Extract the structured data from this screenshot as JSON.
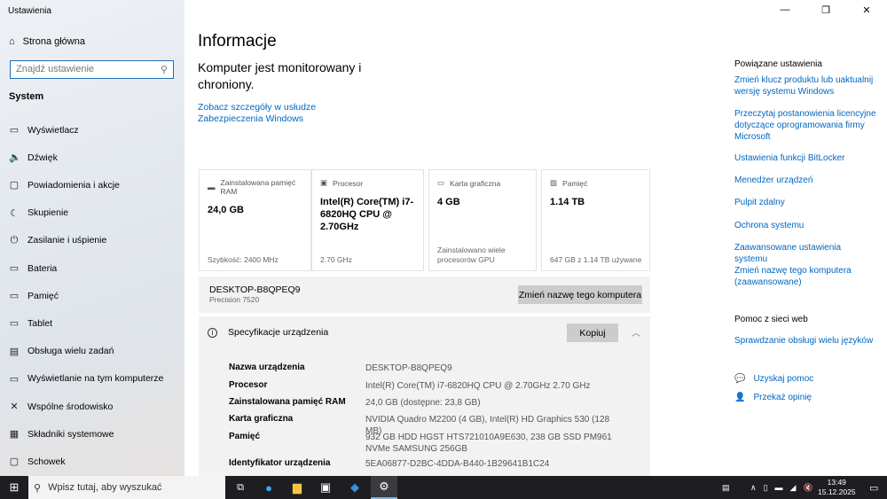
{
  "window": {
    "title": "Ustawienia",
    "minimize": "—",
    "maximize": "❐",
    "close": "✕"
  },
  "sidebar": {
    "home": "Strona główna",
    "search_placeholder": "Znajdź ustawienie",
    "section": "System",
    "items": [
      {
        "label": "Wyświetlacz",
        "icon": "▭"
      },
      {
        "label": "Dźwięk",
        "icon": "🔈"
      },
      {
        "label": "Powiadomienia i akcje",
        "icon": "▢"
      },
      {
        "label": "Skupienie",
        "icon": "☾"
      },
      {
        "label": "Zasilanie i uśpienie",
        "icon": "⏻"
      },
      {
        "label": "Bateria",
        "icon": "▭"
      },
      {
        "label": "Pamięć",
        "icon": "▭"
      },
      {
        "label": "Tablet",
        "icon": "▭"
      },
      {
        "label": "Obsługa wielu zadań",
        "icon": "▤"
      },
      {
        "label": "Wyświetlanie na tym komputerze",
        "icon": "▭"
      },
      {
        "label": "Wspólne środowisko",
        "icon": "✕"
      },
      {
        "label": "Składniki systemowe",
        "icon": "▦"
      },
      {
        "label": "Schowek",
        "icon": "▢"
      }
    ]
  },
  "main": {
    "title": "Informacje",
    "protection": "Komputer jest monitorowany i chroniony.",
    "security_link": "Zobacz szczegóły w usłudze Zabezpieczenia Windows",
    "cards": [
      {
        "label": "Zainstalowana pamięć RAM",
        "value": "24,0 GB",
        "sub": "Szybkość: 2400 MHz"
      },
      {
        "label": "Procesor",
        "value": "Intel(R) Core(TM) i7-6820HQ CPU @ 2.70GHz",
        "sub": "2.70 GHz"
      },
      {
        "label": "Karta graficzna",
        "value": "4 GB",
        "sub": "Zainstalowano wiele procesorów GPU"
      },
      {
        "label": "Pamięć",
        "value": "1.14 TB",
        "sub": "647 GB z 1.14 TB używane"
      }
    ],
    "device_name": "DESKTOP-B8QPEQ9",
    "model": "Precision 7520",
    "rename_button": "Zmień nazwę tego komputera",
    "spec_title": "Specyfikacje urządzenia",
    "copy_button": "Kopiuj",
    "specs": [
      {
        "k": "Nazwa urządzenia",
        "v": "DESKTOP-B8QPEQ9"
      },
      {
        "k": "Procesor",
        "v": "Intel(R) Core(TM) i7-6820HQ CPU @ 2.70GHz   2.70 GHz"
      },
      {
        "k": "Zainstalowana pamięć RAM",
        "v": "24,0 GB (dostępne: 23,8 GB)"
      },
      {
        "k": "Karta graficzna",
        "v": "NVIDIA Quadro M2200 (4 GB), Intel(R) HD Graphics 530 (128 MB)"
      },
      {
        "k": "Pamięć",
        "v": "932 GB HDD HGST HTS721010A9E630, 238 GB SSD PM961 NVMe SAMSUNG 256GB"
      },
      {
        "k": "Identyfikator urządzenia",
        "v": "5EA06877-D2BC-4DDA-B440-1B29641B1C24"
      }
    ]
  },
  "right": {
    "related_title": "Powiązane ustawienia",
    "related": [
      "Zmień klucz produktu lub uaktualnij wersję systemu Windows",
      "Przeczytaj postanowienia licencyjne dotyczące oprogramowania firmy Microsoft",
      "Ustawienia funkcji BitLocker",
      "Menedżer urządzeń",
      "Pulpit zdalny",
      "Ochrona systemu",
      "Zaawansowane ustawienia systemu",
      "Zmień nazwę tego komputera (zaawansowane)"
    ],
    "help_title": "Pomoc z sieci web",
    "help": [
      "Sprawdzanie obsługi wielu języków"
    ],
    "get_help": "Uzyskaj pomoc",
    "feedback": "Przekaż opinię"
  },
  "taskbar": {
    "search_placeholder": "Wpisz tutaj, aby wyszukać",
    "time": "13:49",
    "date": "15.12.2025"
  }
}
